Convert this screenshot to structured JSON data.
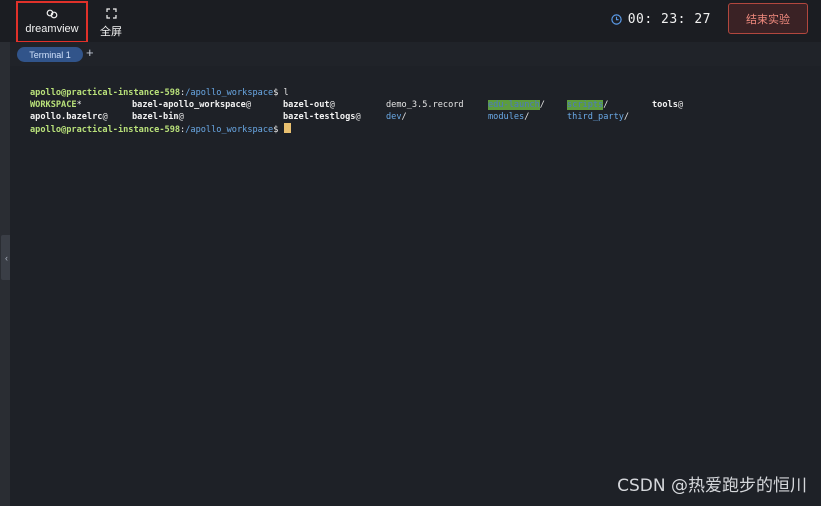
{
  "toolbar": {
    "dreamview_label": "dreamview",
    "fullscreen_label": "全屏",
    "timer": "00: 23: 27",
    "end_button": "结束实验"
  },
  "tabs": {
    "terminal_tab": "Terminal 1",
    "add_tab": "+"
  },
  "terminal": {
    "line1": {
      "user": "apollo@practical-instance-598",
      "sep": ":",
      "path": "/apollo_workspace",
      "cmd": "$ l"
    },
    "listing_row1": [
      {
        "text": "WORKSPACE",
        "suffix": "*",
        "style": "bold-green"
      },
      {
        "text": "bazel-apollo_workspace",
        "suffix": "@",
        "style": "bold-white"
      },
      {
        "text": "bazel-out",
        "suffix": "@",
        "style": "bold-white"
      },
      {
        "text": "demo_3.5.record",
        "suffix": "",
        "style": "plain"
      },
      {
        "text": "edu-launch",
        "suffix": "/",
        "style": "hl"
      },
      {
        "text": "scripts",
        "suffix": "/",
        "style": "hl"
      },
      {
        "text": "tools",
        "suffix": "@",
        "style": "bold-white"
      }
    ],
    "listing_row2": [
      {
        "text": "apollo.bazelrc",
        "suffix": "@",
        "style": "bold-white"
      },
      {
        "text": "bazel-bin",
        "suffix": "@",
        "style": "bold-white"
      },
      {
        "text": "bazel-testlogs",
        "suffix": "@",
        "style": "bold-white"
      },
      {
        "text": "dev",
        "suffix": "/",
        "style": "blue"
      },
      {
        "text": "modules",
        "suffix": "/",
        "style": "blue"
      },
      {
        "text": "third_party",
        "suffix": "/",
        "style": "blue"
      }
    ],
    "line3": {
      "user": "apollo@practical-instance-598",
      "sep": ":",
      "path": "/apollo_workspace",
      "cmd": "$ "
    }
  },
  "watermark": "CSDN @热爱跑步的恒川",
  "colors": {
    "background": "#1e2127",
    "prompt_user": "#b9e17a",
    "path_blue": "#6aa9e6",
    "highlight_green": "#5d9c3e",
    "accent_red": "#e0312a",
    "cursor": "#e8c070"
  },
  "icons": [
    "link-icon",
    "expand-icon",
    "clock-icon",
    "chevron-left-icon"
  ]
}
